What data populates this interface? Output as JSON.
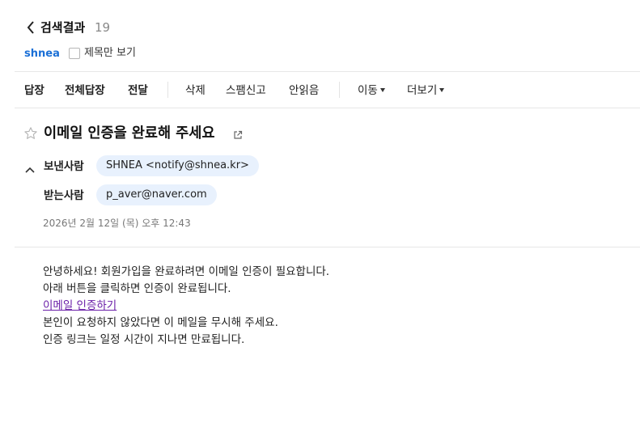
{
  "header": {
    "title": "검색결과",
    "count": "19",
    "sender_chip": "shnea",
    "title_only_label": "제목만 보기"
  },
  "toolbar": {
    "reply": "답장",
    "reply_all": "전체답장",
    "forward": "전달",
    "delete": "삭제",
    "spam": "스팸신고",
    "unread": "안읽음",
    "move": "이동",
    "more": "더보기"
  },
  "mail": {
    "subject": "이메일 인증을 완료해 주세요",
    "from_label": "보낸사람",
    "from_value": "SHNEA <notify@shnea.kr>",
    "to_label": "받는사람",
    "to_value": "p_aver@naver.com",
    "date": "2026년 2월 12일 (목) 오후 12:43"
  },
  "body": {
    "line1": "안녕하세요! 회원가입을 완료하려면 이메일 인증이 필요합니다.",
    "line2": "아래 버튼을 클릭하면 인증이 완료됩니다.",
    "link": "이메일 인증하기",
    "line3": "본인이 요청하지 않았다면 이 메일을 무시해 주세요.",
    "line4": "인증 링크는 일정 시간이 지나면 만료됩니다."
  },
  "colors": {
    "accent": "#1a6fd6",
    "pill_bg": "#e8f1fd",
    "link": "#6a1fa8"
  },
  "icons": {
    "back": "chevron-left-icon",
    "star": "star-outline-icon",
    "popout": "external-link-icon",
    "collapse": "chevron-up-icon",
    "caret": "caret-down-icon"
  }
}
